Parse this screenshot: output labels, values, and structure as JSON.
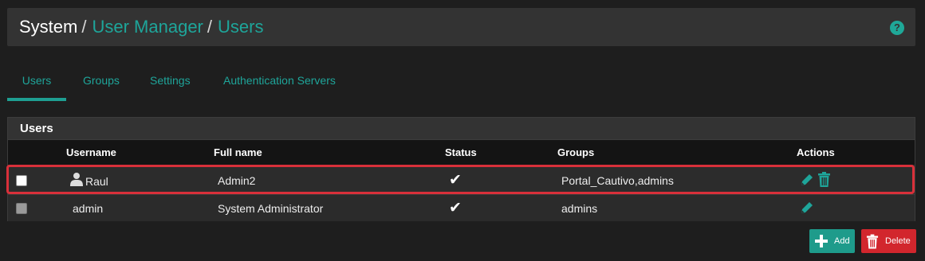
{
  "breadcrumb": {
    "root": "System",
    "separator": "/",
    "items": [
      "User Manager",
      "Users"
    ]
  },
  "help": {
    "icon": "question-circle-icon",
    "glyph": "?"
  },
  "tabs": [
    {
      "label": "Users",
      "active": true
    },
    {
      "label": "Groups",
      "active": false
    },
    {
      "label": "Settings",
      "active": false
    },
    {
      "label": "Authentication Servers",
      "active": false
    }
  ],
  "panel": {
    "title": "Users",
    "columns": [
      "Username",
      "Full name",
      "Status",
      "Groups",
      "Actions"
    ],
    "rows": [
      {
        "checkbox": "checked-off",
        "user_icon": "user-icon",
        "username": "Raul",
        "full_name": "Admin2",
        "status_icon": "checkmark-icon",
        "status_glyph": "✔",
        "groups": "Portal_Cautivo,admins",
        "actions": [
          "edit-pencil-icon",
          "trash-icon"
        ],
        "highlighted": true
      },
      {
        "checkbox": "disabled",
        "username": "admin",
        "full_name": "System Administrator",
        "status_icon": "checkmark-icon",
        "status_glyph": "✔",
        "groups": "admins",
        "actions": [
          "edit-pencil-icon"
        ],
        "highlighted": false
      }
    ]
  },
  "buttons": {
    "add": {
      "label": "Add",
      "icon": "plus-icon"
    },
    "delete": {
      "label": "Delete",
      "icon": "trash-icon"
    }
  },
  "colors": {
    "accent": "#1ea59a",
    "highlight": "#d9303a",
    "delete": "#d2262d",
    "background": "#1e1e1e"
  }
}
